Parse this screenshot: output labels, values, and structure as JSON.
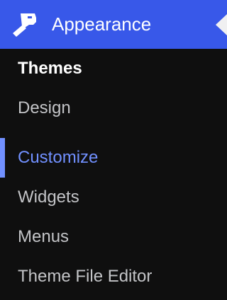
{
  "menu": {
    "title": "Appearance",
    "icon": "paint-brush-icon",
    "colors": {
      "header_bg": "#3858e9",
      "menu_bg": "#0f0f0f",
      "item_text": "#c3c4c7",
      "current_text": "#ffffff",
      "hover_text": "#7190ff",
      "hover_indicator": "#7190ff"
    },
    "items": [
      {
        "label": "Themes",
        "state": "current"
      },
      {
        "label": "Design",
        "state": "normal"
      },
      {
        "label": "Customize",
        "state": "hover"
      },
      {
        "label": "Widgets",
        "state": "normal"
      },
      {
        "label": "Menus",
        "state": "normal"
      },
      {
        "label": "Theme File Editor",
        "state": "normal"
      }
    ]
  }
}
